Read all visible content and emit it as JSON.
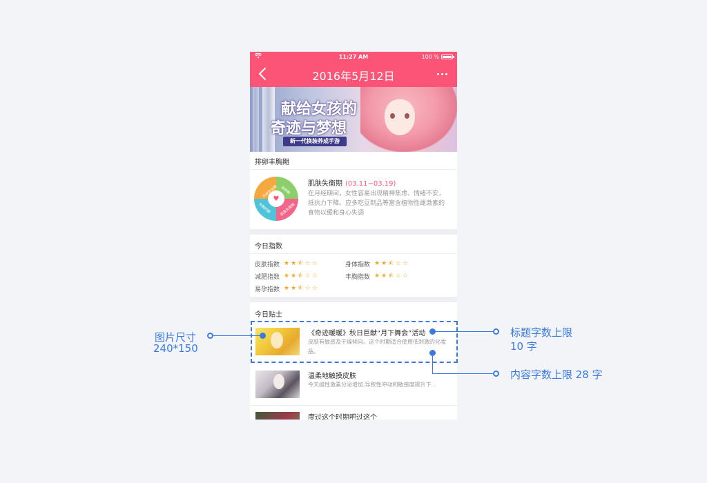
{
  "status_bar": {
    "time": "11:27 AM",
    "battery": "100 %"
  },
  "header": {
    "title": "2016年5月12日"
  },
  "banner": {
    "title_line1": "献给女孩的",
    "title_line2": "奇迹与梦想",
    "tag": "新一代换装养成手游"
  },
  "cycle": {
    "section_title": "排卵丰胸期",
    "wheel_segments": [
      "月经安全期",
      "排卵期",
      "丰胸时期",
      "肌肤失衡期"
    ],
    "skin_title": "肌肤失衡期",
    "skin_date": "(03.11~03.19)",
    "skin_text": "在月经期间，女性容易出现精神焦虑、情绪不安，抵抗力下降。应多吃豆制品等富含植物性雌激素的食物以缓和身心失调"
  },
  "index": {
    "section_title": "今日指数",
    "items": [
      {
        "label": "皮肤指数",
        "stars": "★★⯪☆☆"
      },
      {
        "label": "身体指数",
        "stars": "★★⯪☆☆"
      },
      {
        "label": "减肥指数",
        "stars": "★★⯪☆☆"
      },
      {
        "label": "丰胸指数",
        "stars": "★★⯪☆☆"
      },
      {
        "label": "易孕指数",
        "stars": "★★⯪☆☆"
      }
    ]
  },
  "tips": {
    "section_title": "今日贴士",
    "items": [
      {
        "title": "《奇迹暖暖》秋日巨献“月下舞会”活动",
        "text": "皮肤有敏感及干燥倾向。这个时期适合使用低刺激的化妆品。"
      },
      {
        "title": "温柔地触摸皮肤",
        "text": "今天雌性激素分泌增加,导致性冲动和敏感度提升下..."
      },
      {
        "title": "度过这个时期吧过这个",
        "text": ""
      }
    ]
  },
  "annotations": {
    "image_size_label": "图片尺寸",
    "image_size_value": "240*150",
    "title_limit_label": "标题字数上限",
    "title_limit_value": "10 字",
    "content_limit": "内容字数上限 28 字"
  },
  "colors": {
    "brand": "#fb5476",
    "annotation": "#3a7ae0",
    "star": "#f5a623"
  }
}
